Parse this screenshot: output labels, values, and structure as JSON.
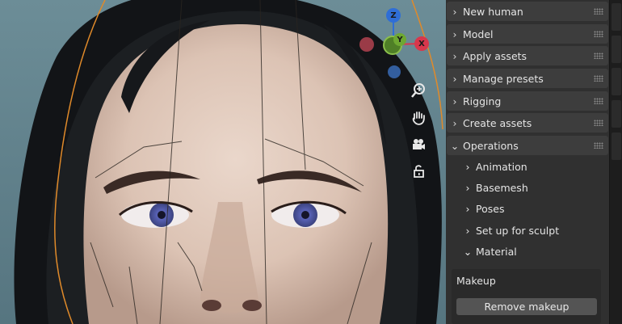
{
  "gizmo": {
    "z_label": "Z",
    "y_label": "Y",
    "x_label": "X",
    "colors": {
      "z": "#2f6ed6",
      "y": "#6ea832",
      "x": "#d8374c"
    }
  },
  "viewport_tools": [
    {
      "name": "zoom-icon",
      "glyph": "zoom"
    },
    {
      "name": "pan-hand-icon",
      "glyph": "hand"
    },
    {
      "name": "camera-icon",
      "glyph": "camera"
    },
    {
      "name": "lock-icon",
      "glyph": "lock"
    }
  ],
  "panels": [
    {
      "label": "New human",
      "expanded": false
    },
    {
      "label": "Model",
      "expanded": false
    },
    {
      "label": "Apply assets",
      "expanded": false
    },
    {
      "label": "Manage presets",
      "expanded": false
    },
    {
      "label": "Rigging",
      "expanded": false
    },
    {
      "label": "Create assets",
      "expanded": false
    },
    {
      "label": "Operations",
      "expanded": true
    }
  ],
  "operations": {
    "items": [
      {
        "label": "Animation",
        "expanded": false
      },
      {
        "label": "Basemesh",
        "expanded": false
      },
      {
        "label": "Poses",
        "expanded": false
      },
      {
        "label": "Set up for sculpt",
        "expanded": false
      },
      {
        "label": "Material",
        "expanded": true
      }
    ],
    "material": {
      "section_label": "Makeup",
      "button_label": "Remove makeup"
    }
  },
  "colors": {
    "panel_bg": "#303030",
    "header_bg": "#3d3d3d",
    "button_bg": "#545454",
    "selection_outline": "#e08a2a"
  }
}
